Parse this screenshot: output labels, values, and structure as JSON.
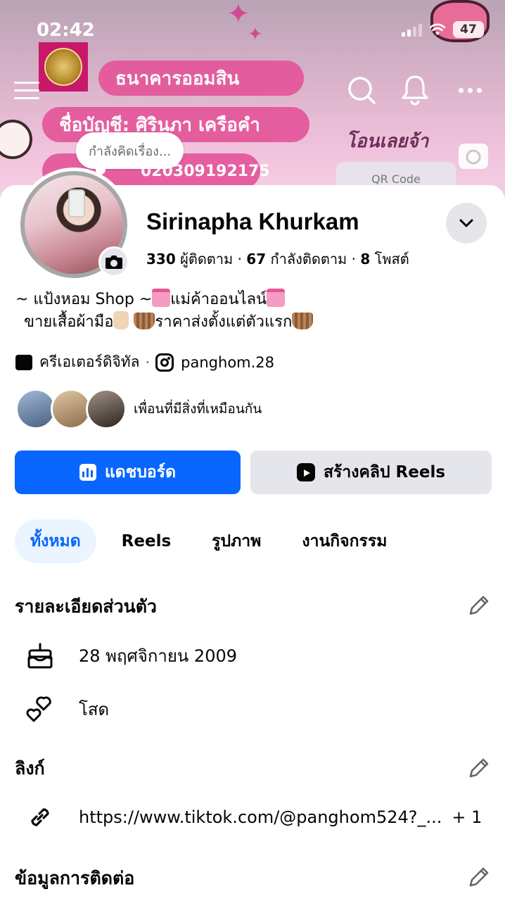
{
  "status_bar": {
    "time": "02:42",
    "battery": "47"
  },
  "cover": {
    "bank_name": "ธนาคารออมสิน",
    "account_name": "ชื่อบัญชี: ศิรินภา เครือคำ",
    "account_number": "020309192175",
    "transfer_text": "โอนเลยจ้า",
    "qr_label": "QR Code"
  },
  "profile": {
    "thought_placeholder": "กำลังคิดเรื่อง...",
    "name": "Sirinapha Khurkam",
    "followers_count": "330",
    "followers_label": "ผู้ติดตาม",
    "following_count": "67",
    "following_label": "กำลังติดตาม",
    "posts_count": "8",
    "posts_label": "โพสต์",
    "bio_line1_a": "~ แป้งหอม Shop ~",
    "bio_line1_b": "แม่ค้าออนไลน์",
    "bio_line2_a": "ขายเสื้อผ้ามือ",
    "bio_line2_b": "ราคาส่งตั้งแต่ตัวแรก",
    "category": "ครีเอเตอร์ดิจิทัล",
    "instagram": "panghom.28",
    "mutual_text": "เพื่อนที่มีสิ่งที่เหมือนกัน"
  },
  "buttons": {
    "dashboard": "แดชบอร์ด",
    "create_reels": "สร้างคลิป Reels"
  },
  "tabs": [
    {
      "label": "ทั้งหมด",
      "active": true
    },
    {
      "label": "Reels",
      "active": false
    },
    {
      "label": "รูปภาพ",
      "active": false
    },
    {
      "label": "งานกิจกรรม",
      "active": false
    }
  ],
  "details": {
    "title": "รายละเอียดส่วนตัว",
    "birthday": "28 พฤศจิกายน  2009",
    "relationship": "โสด"
  },
  "links": {
    "title": "ลิงก์",
    "url": "https://www.tiktok.com/@panghom524?_...",
    "extra": "+ 1"
  },
  "contact": {
    "title": "ข้อมูลการติดต่อ"
  },
  "colors": {
    "primary": "#0866ff",
    "secondary_bg": "#e4e6eb",
    "active_tab_bg": "#ebf5ff"
  }
}
